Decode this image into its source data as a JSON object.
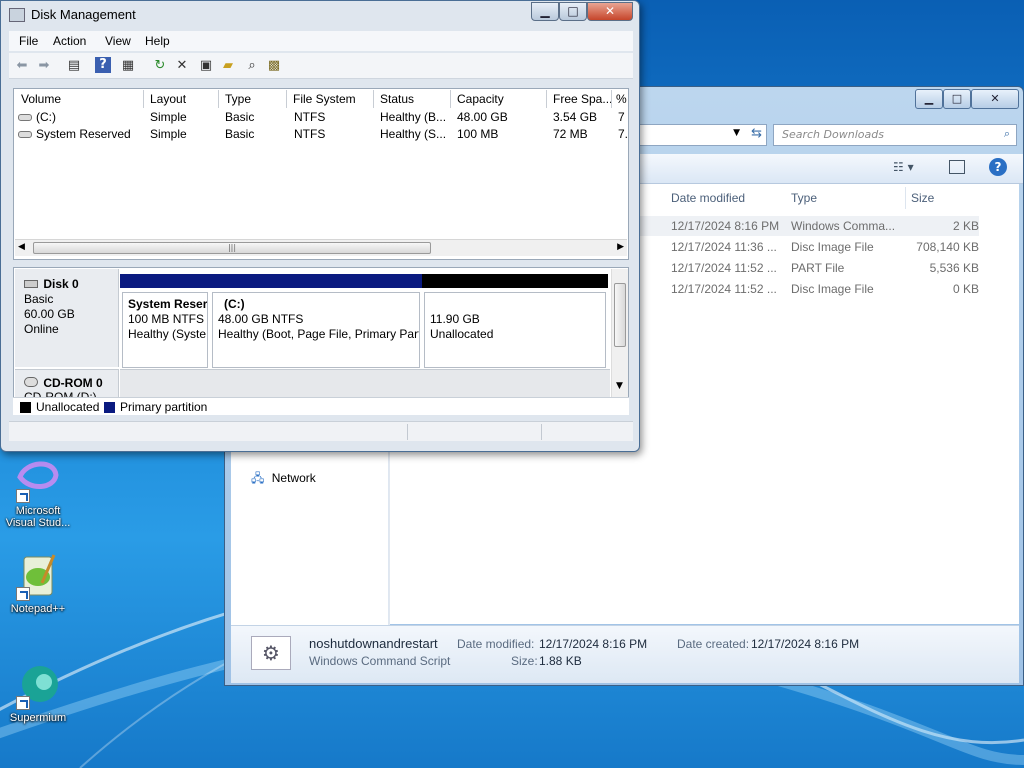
{
  "desktop": {
    "icons": [
      {
        "label": "Microsoft Visual Stud..."
      },
      {
        "label": "Notepad++"
      },
      {
        "label": "Supermium"
      }
    ]
  },
  "explorer": {
    "search_placeholder": "Search Downloads",
    "columns": [
      "Date modified",
      "Type",
      "Size"
    ],
    "files": [
      {
        "date": "12/17/2024 8:16 PM",
        "type": "Windows Comma...",
        "size": "2 KB"
      },
      {
        "date": "12/17/2024 11:36 ...",
        "type": "Disc Image File",
        "size": "708,140 KB"
      },
      {
        "date": "12/17/2024 11:52 ...",
        "type": "PART File",
        "size": "5,536 KB"
      },
      {
        "date": "12/17/2024 11:52 ...",
        "type": "Disc Image File",
        "size": "0 KB"
      }
    ],
    "nav": {
      "network": "Network"
    },
    "details": {
      "name": "noshutdownandrestart",
      "type": "Windows Command Script",
      "modified_label": "Date modified:",
      "modified": "12/17/2024 8:16 PM",
      "created_label": "Date created:",
      "created": "12/17/2024 8:16 PM",
      "size_label": "Size:",
      "size": "1.88 KB"
    }
  },
  "disk_management": {
    "title": "Disk Management",
    "menu": [
      "File",
      "Action",
      "View",
      "Help"
    ],
    "volume_columns": [
      "Volume",
      "Layout",
      "Type",
      "File System",
      "Status",
      "Capacity",
      "Free Spa...",
      "%"
    ],
    "volumes": [
      {
        "volume": "(C:)",
        "layout": "Simple",
        "type": "Basic",
        "fs": "NTFS",
        "status": "Healthy (B...",
        "capacity": "48.00 GB",
        "free": "3.54 GB",
        "pct": "7"
      },
      {
        "volume": "System Reserved",
        "layout": "Simple",
        "type": "Basic",
        "fs": "NTFS",
        "status": "Healthy (S...",
        "capacity": "100 MB",
        "free": "72 MB",
        "pct": "7."
      }
    ],
    "disk0": {
      "name": "Disk 0",
      "kind": "Basic",
      "size": "60.00 GB",
      "state": "Online",
      "partitions": [
        {
          "title": "System Reser",
          "line1": "100 MB NTFS",
          "line2": "Healthy (Syste"
        },
        {
          "title": "(C:)",
          "line1": "48.00 GB NTFS",
          "line2": "Healthy (Boot, Page File, Primary Part"
        },
        {
          "title": "",
          "line1": "11.90 GB",
          "line2": "Unallocated"
        }
      ]
    },
    "cdrom": {
      "name": "CD-ROM 0",
      "cut": "CD-ROM (D:)"
    },
    "legend": [
      "Unallocated",
      "Primary partition"
    ],
    "colors": {
      "primary": "#0a1a80",
      "unallocated": "#000000"
    }
  }
}
